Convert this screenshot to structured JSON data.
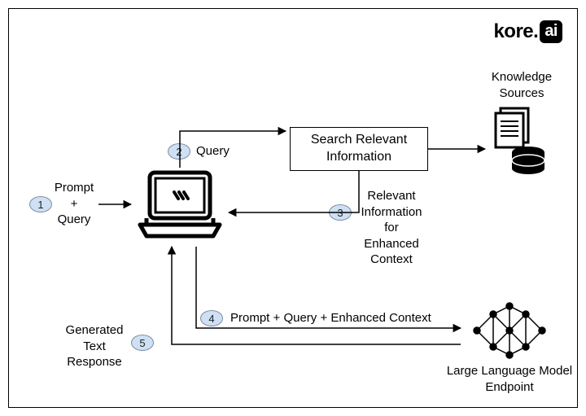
{
  "logo": {
    "prefix": "kore",
    "dot": ".",
    "suffix": "ai"
  },
  "steps": {
    "s1": {
      "num": "1",
      "label": "Prompt\n+\nQuery"
    },
    "s2": {
      "num": "2",
      "label": "Query"
    },
    "s3": {
      "num": "3",
      "label": "Relevant\nInformation\nfor\nEnhanced\nContext"
    },
    "s4": {
      "num": "4",
      "label": "Prompt  + Query + Enhanced Context"
    },
    "s5": {
      "num": "5",
      "label": "Generated\nText\nResponse"
    }
  },
  "boxes": {
    "search": "Search Relevant\nInformation"
  },
  "blocks": {
    "knowledge_sources": "Knowledge\nSources",
    "llm": "Large Language Model\nEndpoint"
  }
}
